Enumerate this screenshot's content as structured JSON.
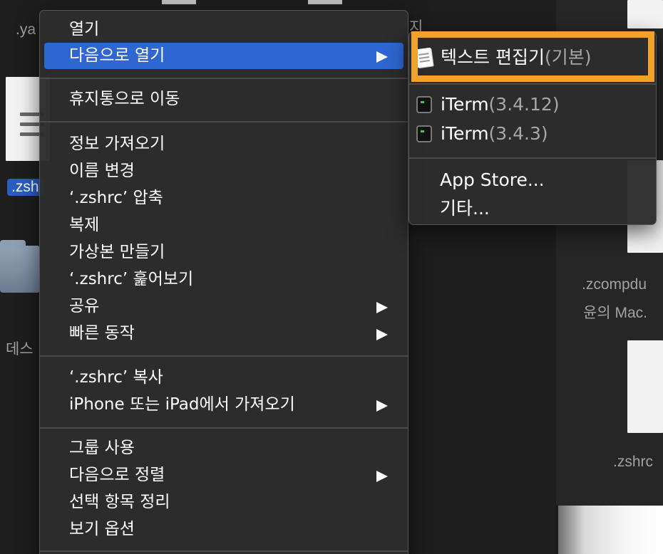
{
  "background": {
    "labels": {
      "top_left": ".ya",
      "zsh_selected": ".zsh",
      "desktop": "데스",
      "zcompdump": ".zcompdu",
      "yun_mac": "윤의 Mac.",
      "zshrc_right": ".zshrc",
      "top_fragment": "지"
    }
  },
  "context_menu": {
    "groups": [
      [
        {
          "label": "열기",
          "submenu": false,
          "highlighted": false
        },
        {
          "label": "다음으로 열기",
          "submenu": true,
          "highlighted": true
        }
      ],
      [
        {
          "label": "휴지통으로 이동",
          "submenu": false,
          "highlighted": false
        }
      ],
      [
        {
          "label": "정보 가져오기",
          "submenu": false,
          "highlighted": false
        },
        {
          "label": "이름 변경",
          "submenu": false,
          "highlighted": false
        },
        {
          "label": "‘.zshrc’ 압축",
          "submenu": false,
          "highlighted": false
        },
        {
          "label": "복제",
          "submenu": false,
          "highlighted": false
        },
        {
          "label": "가상본 만들기",
          "submenu": false,
          "highlighted": false
        },
        {
          "label": "‘.zshrc’ 훑어보기",
          "submenu": false,
          "highlighted": false
        },
        {
          "label": "공유",
          "submenu": true,
          "highlighted": false
        },
        {
          "label": "빠른 동작",
          "submenu": true,
          "highlighted": false
        }
      ],
      [
        {
          "label": "‘.zshrc’ 복사",
          "submenu": false,
          "highlighted": false
        },
        {
          "label": "iPhone 또는 iPad에서 가져오기",
          "submenu": true,
          "highlighted": false
        }
      ],
      [
        {
          "label": "그룹 사용",
          "submenu": false,
          "highlighted": false
        },
        {
          "label": "다음으로 정렬",
          "submenu": true,
          "highlighted": false
        },
        {
          "label": "선택 항목 정리",
          "submenu": false,
          "highlighted": false
        },
        {
          "label": "보기 옵션",
          "submenu": false,
          "highlighted": false
        }
      ]
    ]
  },
  "open_with_submenu": {
    "items": [
      {
        "app": "텍스트 편집기",
        "suffix": "(기본)",
        "icon": "textedit-icon"
      },
      {
        "app": "iTerm",
        "suffix": "(3.4.12)",
        "icon": "iterm-icon"
      },
      {
        "app": "iTerm",
        "suffix": "(3.4.3)",
        "icon": "iterm-icon"
      }
    ],
    "extra": [
      {
        "label": "App Store..."
      },
      {
        "label": "기타..."
      }
    ],
    "highlight_color": "#f0a22b"
  },
  "colors": {
    "menu_highlight": "#2f67d2",
    "annotation_box": "#f0a22b"
  }
}
